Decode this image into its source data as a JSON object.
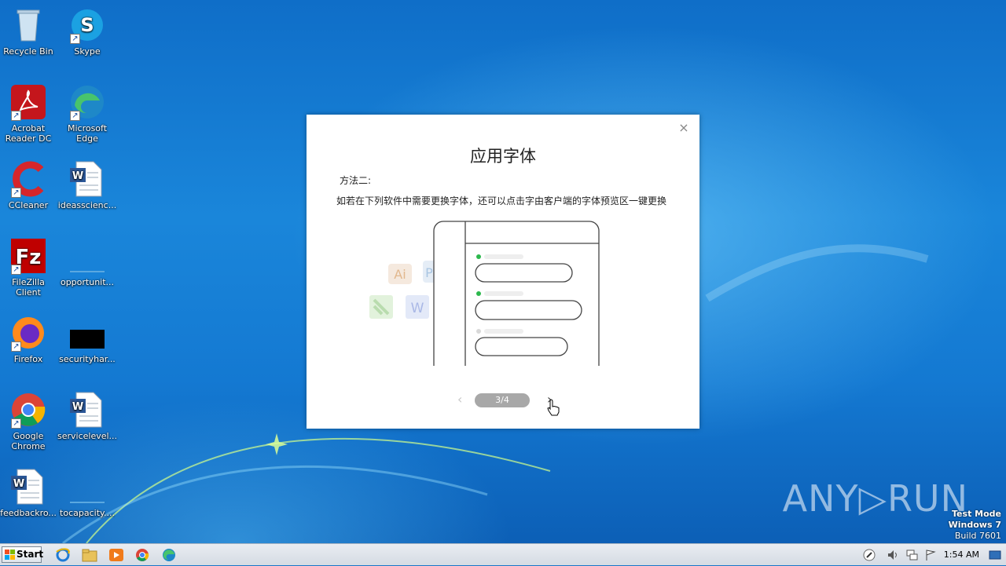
{
  "desktop": {
    "icons": [
      {
        "label": "Recycle Bin",
        "icon": "recycle-bin-icon"
      },
      {
        "label": "Skype",
        "icon": "skype-icon"
      },
      {
        "label": "Acrobat Reader DC",
        "icon": "acrobat-icon"
      },
      {
        "label": "Microsoft Edge",
        "icon": "edge-icon"
      },
      {
        "label": "CCleaner",
        "icon": "ccleaner-icon"
      },
      {
        "label": "ideasscienc...",
        "icon": "word-doc-icon"
      },
      {
        "label": "FileZilla Client",
        "icon": "filezilla-icon"
      },
      {
        "label": "opportunit...",
        "icon": "blank-file-icon"
      },
      {
        "label": "Firefox",
        "icon": "firefox-icon"
      },
      {
        "label": "securityhar...",
        "icon": "black-file-icon"
      },
      {
        "label": "Google Chrome",
        "icon": "chrome-icon"
      },
      {
        "label": "servicelevel...",
        "icon": "word-doc-icon"
      },
      {
        "label": "feedbackro...",
        "icon": "word-doc-icon"
      },
      {
        "label": "tocapacity....",
        "icon": "blank-file-icon"
      }
    ]
  },
  "dialog": {
    "close_glyph": "×",
    "title": "应用字体",
    "method": "方法二:",
    "description": "如若在下列软件中需要更换字体，还可以点击字由客户端的字体预览区一键更换",
    "illustration": {
      "app_labels": [
        "Ai",
        "P",
        "W"
      ]
    },
    "pager": {
      "text": "3/4",
      "prev_glyph": "‹",
      "next_glyph": "›"
    }
  },
  "watermark": {
    "text": "ANY▷RUN"
  },
  "test_mode": {
    "line1": "Test Mode",
    "line2": "Windows 7",
    "line3": "Build 7601"
  },
  "taskbar": {
    "start_label": "Start",
    "apps": [
      "internet-explorer-icon",
      "file-explorer-icon",
      "media-player-icon",
      "chrome-icon",
      "edge-icon"
    ],
    "clock": "1:54 AM"
  },
  "colors": {
    "accent_green": "#2db84d",
    "desktop_blue": "#1a76c8"
  }
}
